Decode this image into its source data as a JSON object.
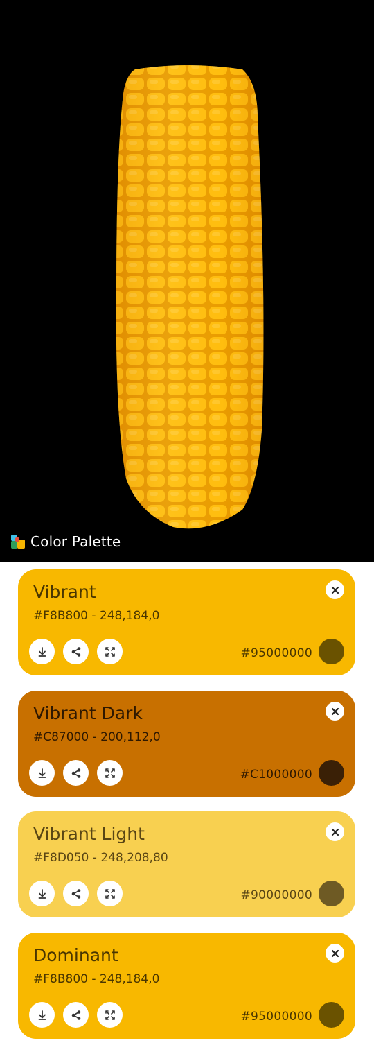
{
  "app": {
    "title": "Color Palette",
    "logo_icon": "palette-logo-icon"
  },
  "image": {
    "subject": "corn-cob",
    "background": "#000000",
    "kernel_color": "#F8B800"
  },
  "cards": [
    {
      "title": "Vibrant",
      "subtitle": "#F8B800 - 248,184,0",
      "overlay_hex": "#95000000",
      "bg": "#F8B800",
      "text": "#4A3600",
      "swatch": "#6A5200",
      "icons": [
        "download-icon",
        "share-icon",
        "expand-icon",
        "close-icon"
      ]
    },
    {
      "title": "Vibrant Dark",
      "subtitle": "#C87000 - 200,112,0",
      "overlay_hex": "#C1000000",
      "bg": "#C87000",
      "text": "#2E1800",
      "swatch": "#3A2006",
      "icons": [
        "download-icon",
        "share-icon",
        "expand-icon",
        "close-icon"
      ]
    },
    {
      "title": "Vibrant Light",
      "subtitle": "#F8D050 - 248,208,80",
      "overlay_hex": "#90000000",
      "bg": "#F8D050",
      "text": "#5A4614",
      "swatch": "#6E5A24",
      "icons": [
        "download-icon",
        "share-icon",
        "expand-icon",
        "close-icon"
      ]
    },
    {
      "title": "Dominant",
      "subtitle": "#F8B800 - 248,184,0",
      "overlay_hex": "#95000000",
      "bg": "#F8B800",
      "text": "#4A3600",
      "swatch": "#6A5200",
      "icons": [
        "download-icon",
        "share-icon",
        "expand-icon",
        "close-icon"
      ]
    }
  ]
}
